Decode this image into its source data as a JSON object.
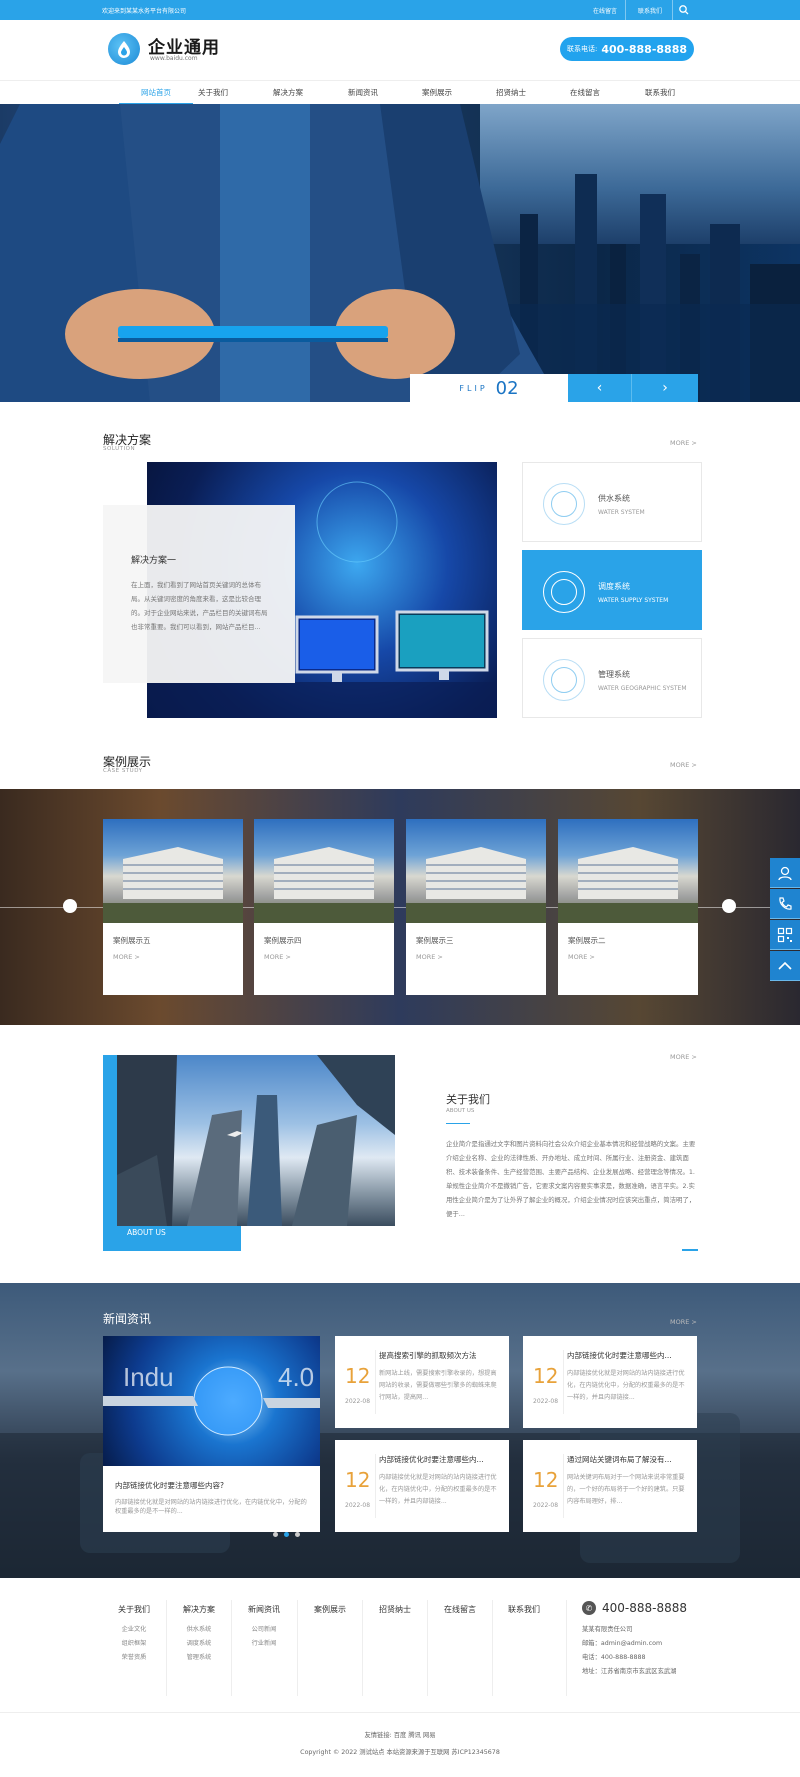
{
  "topbar": {
    "welcome": "欢迎来到某某水务平台有限公司",
    "links": [
      "在线留言",
      "联系我们"
    ]
  },
  "header": {
    "logo_name": "企业通用",
    "logo_url": "www.baidu.com",
    "hotline_label": "联系电话:",
    "hotline_number": "400-888-8888"
  },
  "nav": {
    "items": [
      "网站首页",
      "关于我们",
      "解决方案",
      "新闻资讯",
      "案例展示",
      "招贤纳士",
      "在线留言",
      "联系我们"
    ],
    "active": 0
  },
  "banner": {
    "flip_label": "FLIP",
    "flip_number": "02",
    "prev": "‹",
    "next": "›"
  },
  "solution": {
    "title": "解决方案",
    "subtitle": "SOLUTION",
    "more": "MORE >",
    "card_title": "解决方案一",
    "card_text": "在上面，我们看到了网站首页关键词的总体布局。从关键词密度的角度来看，这是比较合理的。对于企业网站来说，产品栏目的关键词布局也非常重要。我们可以看到，网站产品栏目...",
    "systems": [
      {
        "name": "供水系统",
        "en": "WATER SYSTEM"
      },
      {
        "name": "调度系统",
        "en": "WATER SUPPLY SYSTEM"
      },
      {
        "name": "管理系统",
        "en": "WATER GEOGRAPHIC SYSTEM"
      }
    ]
  },
  "cases": {
    "title": "案例展示",
    "subtitle": "CASE STUDY",
    "more": "MORE >",
    "items": [
      {
        "name": "案例展示五",
        "more": "MORE >"
      },
      {
        "name": "案例展示四",
        "more": "MORE >"
      },
      {
        "name": "案例展示三",
        "more": "MORE >"
      },
      {
        "name": "案例展示二",
        "more": "MORE >"
      }
    ]
  },
  "about": {
    "more": "MORE >",
    "label": "ABOUT US",
    "title": "关于我们",
    "subtitle": "ABOUT US",
    "text": "企业简介是指通过文字和图片资料向社会公众介绍企业基本情况和经营战略的文案。主要介绍企业名称、企业的法律性质、开办地址、成立时间、所属行业、注册资金、建筑面积、技术装备条件、生产经营范围、主要产品结构、企业发展战略、经营理念等情况。1.单规性企业简介不是撒销广告，它要求文案内容要实事求是，数据准确，语言平实。2.实用性企业简介是为了让外界了解企业的概况，介绍企业情况时应该突出重点，简洁明了，便于..."
  },
  "news": {
    "title": "新闻资讯",
    "more": "MORE >",
    "featured": {
      "title": "内部链接优化时要注意哪些内容?",
      "text": "内部链接优化就是对网站的站内链接进行优化，在内链优化中，分配的权重最多的是不一样的..."
    },
    "items": [
      {
        "day": "12",
        "ym": "2022-08",
        "title": "提高搜索引擎的抓取频次方法",
        "text": "新网站上线，需要搜索引擎收录的，想提高网站的收录，需要做哪些引擎多的蜘蛛来爬行网站，提高网..."
      },
      {
        "day": "12",
        "ym": "2022-08",
        "title": "内部链接优化时要注意哪些内...",
        "text": "内部链接优化就是对网站的站内链接进行优化，在内链优化中，分配的权重最多的是不一样的，并且内部链接..."
      },
      {
        "day": "12",
        "ym": "2022-08",
        "title": "内部链接优化时要注意哪些内...",
        "text": "内部链接优化就是对网站的站内链接进行优化，在内链优化中，分配的权重最多的是不一样的，并且内部链接..."
      },
      {
        "day": "12",
        "ym": "2022-08",
        "title": "通过网站关键词布局了解没有...",
        "text": "网站关键词布局对于一个网站来说非常重要的，一个好的布局将于一个好的建筑。只要内容布局理好，排..."
      }
    ]
  },
  "footer": {
    "columns": [
      {
        "title": "关于我们",
        "links": [
          "企业文化",
          "组织框架",
          "荣誉资质"
        ]
      },
      {
        "title": "解决方案",
        "links": [
          "供水系统",
          "调度系统",
          "管理系统"
        ]
      },
      {
        "title": "新闻资讯",
        "links": [
          "公司新闻",
          "行业新闻"
        ]
      },
      {
        "title": "案例展示",
        "links": []
      },
      {
        "title": "招贤纳士",
        "links": []
      },
      {
        "title": "在线留言",
        "links": []
      },
      {
        "title": "联系我们",
        "links": []
      }
    ],
    "phone": "400-888-8888",
    "company": "某某有限责任公司",
    "email": "邮箱：admin@admin.com",
    "tel": "电话：400-888-8888",
    "address": "地址：江苏省南京市玄武区玄武湖",
    "friend_links": "友情链接:  百度  腾讯  网易",
    "copyright": "Copyright © 2022 测试站点 本站资源来源于互联网  苏ICP12345678"
  },
  "colors": {
    "primary": "#2aa3e8",
    "accent": "#e8a23a"
  }
}
